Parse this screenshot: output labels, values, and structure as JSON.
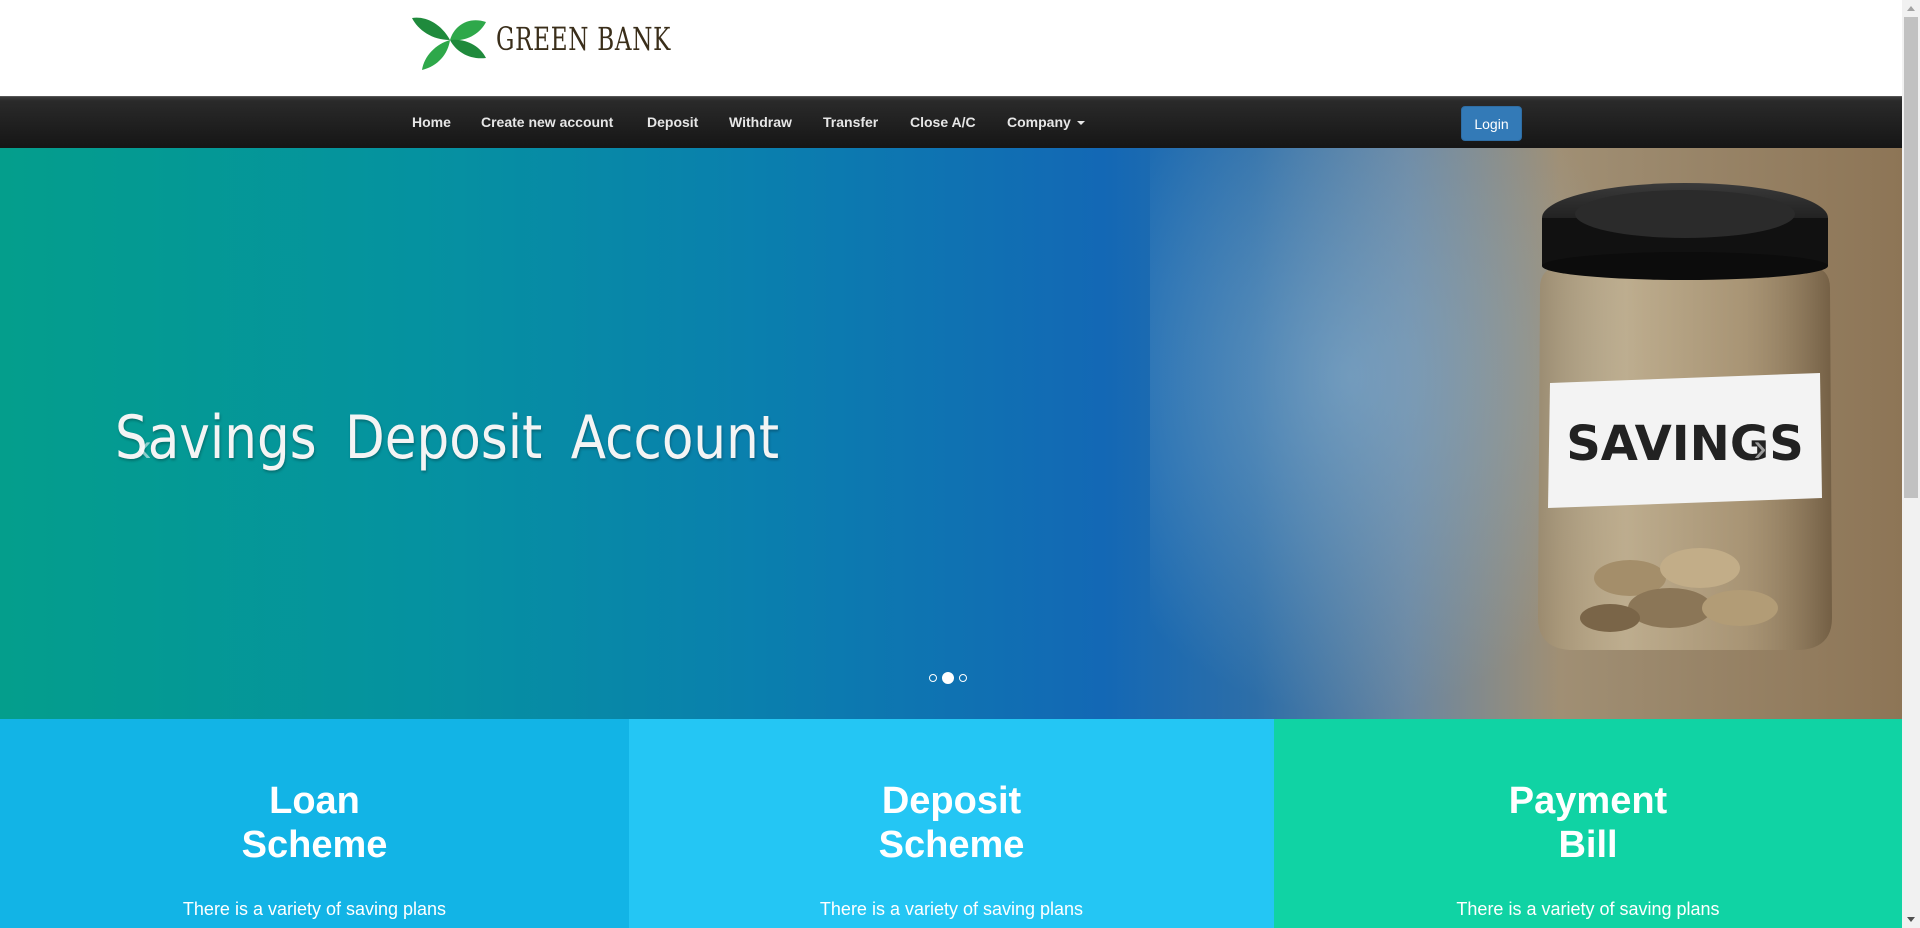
{
  "brand": {
    "logo_text": "GREEN BANK",
    "logo_icon": "four-leaf-icon"
  },
  "nav": {
    "items": [
      {
        "label": "Home"
      },
      {
        "label": "Create new account"
      },
      {
        "label": "Deposit"
      },
      {
        "label": "Withdraw"
      },
      {
        "label": "Transfer"
      },
      {
        "label": "Close A/C"
      },
      {
        "label": "Company"
      }
    ],
    "login_label": "Login"
  },
  "hero": {
    "title": "Savings  Deposit  Account",
    "jar_label": "SAVINGS",
    "prev_icon": "chevron-left-icon",
    "next_icon": "chevron-right-icon",
    "slide_count": 3,
    "active_slide": 2
  },
  "panels": [
    {
      "title_line1": "Loan",
      "title_line2": "Scheme",
      "text": "There is a variety of saving plans",
      "color": "#12b4e6"
    },
    {
      "title_line1": "Deposit",
      "title_line2": "Scheme",
      "text": "There is a variety of saving plans",
      "color": "#24c6f4"
    },
    {
      "title_line1": "Payment",
      "title_line2": "Bill",
      "text": "There is a variety of saving plans",
      "color": "#10d3a4"
    }
  ],
  "colors": {
    "login_button": "#337ab7",
    "navbar": "#1e1e1e"
  }
}
